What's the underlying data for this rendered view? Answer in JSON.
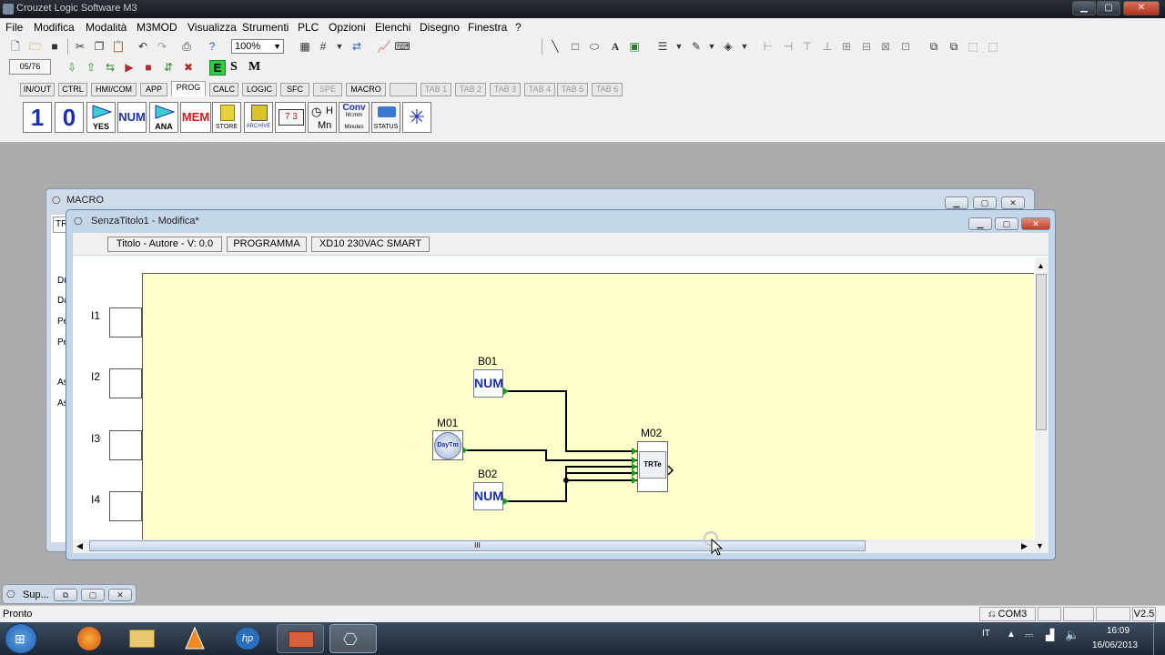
{
  "window": {
    "title": "Crouzet Logic Software M3",
    "minimize": "▁",
    "maximize": "▢",
    "close": "✕"
  },
  "menu": [
    "File",
    "Modifica",
    "Modalità",
    "M3MOD",
    "Visualizza",
    "Strumenti",
    "PLC",
    "Opzioni",
    "Elenchi",
    "Disegno",
    "Finestra",
    "?"
  ],
  "toolbar": {
    "zoom": "100%",
    "counter": "05/76",
    "mode_e": "E",
    "mode_s": "S",
    "mode_m": "M"
  },
  "tabs": [
    {
      "label": "IN/OUT",
      "disabled": false
    },
    {
      "label": "CTRL",
      "disabled": false
    },
    {
      "label": "HMI/COM",
      "disabled": false
    },
    {
      "label": "APP",
      "disabled": false
    },
    {
      "label": "PROG",
      "disabled": false,
      "active": true
    },
    {
      "label": "CALC",
      "disabled": false
    },
    {
      "label": "LOGIC",
      "disabled": false
    },
    {
      "label": "SFC",
      "disabled": false
    },
    {
      "label": "SPE",
      "disabled": true
    },
    {
      "label": "MACRO",
      "disabled": false
    },
    {
      "label": "",
      "disabled": true
    },
    {
      "label": "TAB 1",
      "disabled": true
    },
    {
      "label": "TAB 2",
      "disabled": true
    },
    {
      "label": "TAB 3",
      "disabled": true
    },
    {
      "label": "TAB 4",
      "disabled": true
    },
    {
      "label": "TAB 5",
      "disabled": true
    },
    {
      "label": "TAB 6",
      "disabled": true
    }
  ],
  "palette": {
    "one": "1",
    "zero": "0",
    "yes": "YES",
    "num": "NUM",
    "ana": "ANA",
    "mem": "MEM",
    "store": "STORE",
    "archive": "ARCHIVE",
    "h": "H",
    "mn": "Mn",
    "conv": "Conv",
    "conv_sub1": "hh:mm",
    "conv_sub2": "Minutes",
    "status": "STATUS"
  },
  "macro_window": {
    "title": "MACRO",
    "field": "TR",
    "labels": [
      "Du",
      "Da",
      "Pe",
      "Pe",
      "As",
      "As"
    ]
  },
  "editor_window": {
    "title": "SenzaTitolo1 - Modifica*",
    "info": [
      "Titolo - Autore - V: 0.0",
      "PROGRAMMA",
      "XD10 230VAC SMART"
    ],
    "inputs": [
      "I1",
      "I2",
      "I3",
      "I4"
    ],
    "blocks": {
      "b01": {
        "label": "B01",
        "text": "NUM"
      },
      "b02": {
        "label": "B02",
        "text": "NUM"
      },
      "m01": {
        "label": "M01",
        "text": "DayTm"
      },
      "m02": {
        "label": "M02",
        "text": "TRTe"
      }
    },
    "scroll_mid": "III"
  },
  "minimized_window": {
    "title": "Sup..."
  },
  "status": {
    "text": "Pronto",
    "port": "COM3",
    "version": "V2.5"
  },
  "taskbar": {
    "lang": "IT",
    "time": "16:09",
    "date": "16/06/2013"
  }
}
